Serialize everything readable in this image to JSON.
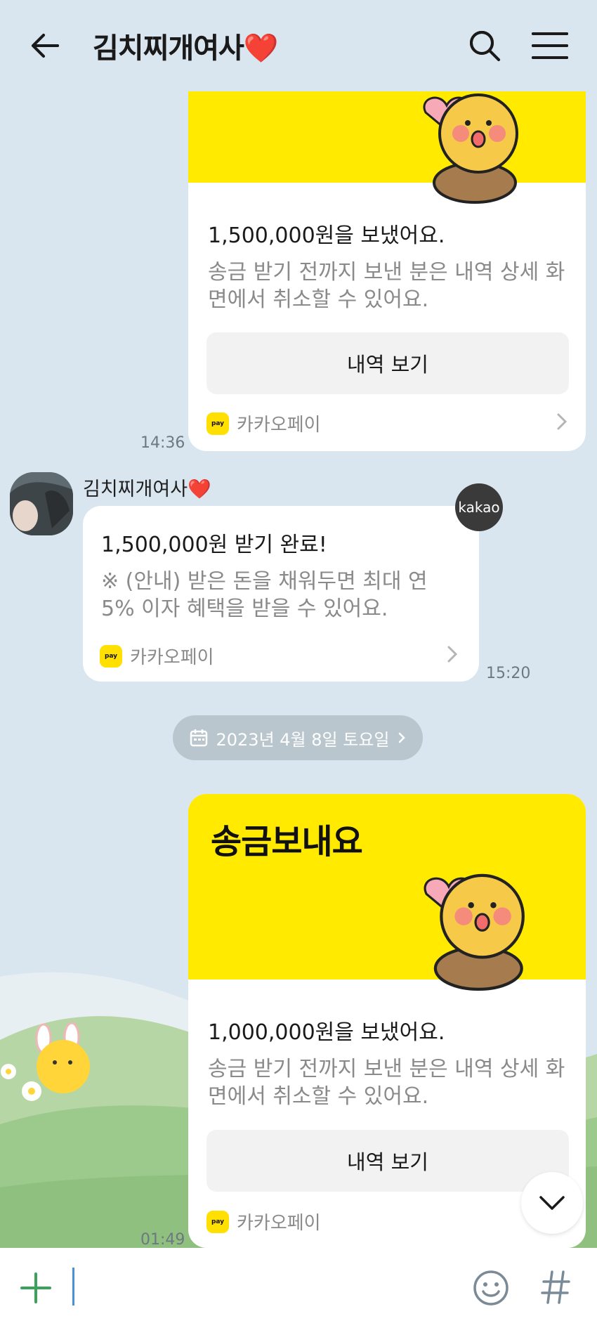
{
  "header": {
    "title": "김치찌개여사❤️",
    "back_icon": "arrow-left-icon",
    "search_icon": "search-icon",
    "menu_icon": "hamburger-menu-icon"
  },
  "messages": {
    "sent_1": {
      "amount": "1,500,000원을 보냈어요.",
      "description": "송금 받기 전까지 보낸 분은 내역 상세 화면에서 취소할 수 있어요.",
      "button": "내역 보기",
      "brand": "카카오페이",
      "time": "14:36"
    },
    "received_1": {
      "sender": "김치찌개여사❤️",
      "badge": "kakao",
      "title": "1,500,000원 받기 완료!",
      "description": "※ (안내) 받은 돈을 채워두면 최대 연 5% 이자 혜택을 받을 수 있어요.",
      "brand": "카카오페이",
      "time": "15:20"
    },
    "date_divider": "2023년 4월 8일 토요일",
    "sent_2": {
      "header": "송금보내요",
      "amount": "1,000,000원을 보냈어요.",
      "description": "송금 받기 전까지 보낸 분은 내역 상세 화면에서 취소할 수 있어요.",
      "button": "내역 보기",
      "brand": "카카오페이",
      "time": "01:49"
    }
  },
  "pay_badge_text": "pay",
  "input": {
    "value": "",
    "placeholder": ""
  },
  "colors": {
    "background": "#d9e6ef",
    "kakao_yellow": "#ffea00",
    "plus_green": "#3aa35a"
  }
}
